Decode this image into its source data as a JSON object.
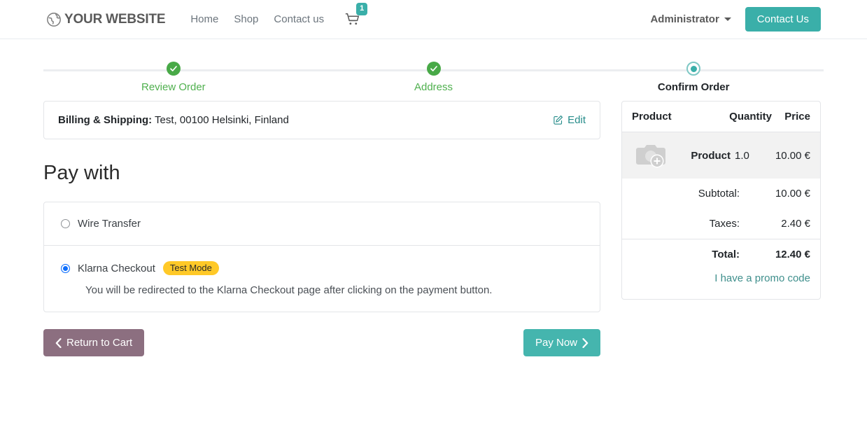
{
  "header": {
    "brand_icon": "globe-icon",
    "brand_text": "YOUR WEBSITE",
    "nav_links": [
      {
        "label": "Home"
      },
      {
        "label": "Shop"
      },
      {
        "label": "Contact us"
      }
    ],
    "cart": {
      "icon": "shopping-cart-icon",
      "count": "1"
    },
    "user_menu": "Administrator",
    "contact_button": "Contact Us"
  },
  "stepper": {
    "steps": [
      {
        "label": "Review Order",
        "state": "done"
      },
      {
        "label": "Address",
        "state": "done"
      },
      {
        "label": "Confirm Order",
        "state": "current"
      }
    ]
  },
  "billing": {
    "label": "Billing & Shipping:",
    "address": " Test, 00100 Helsinki, Finland",
    "edit_label": "Edit"
  },
  "payment": {
    "title": "Pay with",
    "methods": [
      {
        "label": "Wire Transfer",
        "selected": false,
        "badge": "",
        "description": ""
      },
      {
        "label": "Klarna Checkout",
        "selected": true,
        "badge": "Test Mode",
        "description": "You will be redirected to the Klarna Checkout page after clicking on the payment button."
      }
    ]
  },
  "actions": {
    "return_label": "Return to Cart",
    "pay_label": "Pay Now"
  },
  "summary": {
    "columns": {
      "product": "Product",
      "quantity": "Quantity",
      "price": "Price"
    },
    "items": [
      {
        "image_icon": "image-placeholder-icon",
        "name": "Product",
        "quantity": "1.0",
        "price": "10.00 €"
      }
    ],
    "subtotal_label": "Subtotal:",
    "subtotal_value": "10.00 €",
    "taxes_label": "Taxes:",
    "taxes_value": "2.40 €",
    "total_label": "Total:",
    "total_value": "12.40 €",
    "promo_label": "I have a promo code"
  },
  "colors": {
    "accent_teal": "#3aafa9",
    "step_done_green": "#48a947",
    "badge_amber": "#ffc928",
    "return_button": "#8c6f80",
    "radio_selected_blue": "#0d6efd"
  }
}
